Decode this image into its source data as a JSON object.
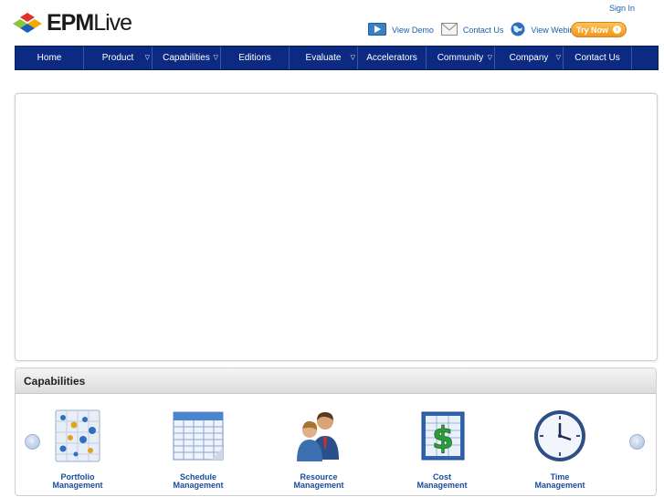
{
  "header": {
    "logo_main": "EPM",
    "logo_sub": "Live",
    "signin": "Sign In",
    "links": [
      {
        "label": "View Demo",
        "icon": "play-video-icon"
      },
      {
        "label": "Contact Us",
        "icon": "envelope-icon"
      },
      {
        "label": "View Webinars",
        "icon": "globe-icon"
      }
    ],
    "try_now": "Try Now"
  },
  "nav": {
    "items": [
      {
        "label": "Home",
        "dropdown": false
      },
      {
        "label": "Product",
        "dropdown": true
      },
      {
        "label": "Capabilities",
        "dropdown": true
      },
      {
        "label": "Editions",
        "dropdown": false
      },
      {
        "label": "Evaluate",
        "dropdown": true
      },
      {
        "label": "Accelerators",
        "dropdown": false
      },
      {
        "label": "Community",
        "dropdown": true
      },
      {
        "label": "Company",
        "dropdown": true
      },
      {
        "label": "Contact Us",
        "dropdown": false
      }
    ]
  },
  "capabilities": {
    "title": "Capabilities",
    "items": [
      {
        "line1": "Portfolio",
        "line2": "Management",
        "icon": "portfolio-chart-icon"
      },
      {
        "line1": "Schedule",
        "line2": "Management",
        "icon": "schedule-grid-icon"
      },
      {
        "line1": "Resource",
        "line2": "Management",
        "icon": "people-icon"
      },
      {
        "line1": "Cost",
        "line2": "Management",
        "icon": "dollar-ledger-icon"
      },
      {
        "line1": "Time",
        "line2": "Management",
        "icon": "clock-icon"
      }
    ]
  },
  "colors": {
    "nav_bg": "#0d2a82",
    "link": "#1a5fa8",
    "try_now": "#f0961a",
    "cap_label": "#1a4ea0"
  }
}
